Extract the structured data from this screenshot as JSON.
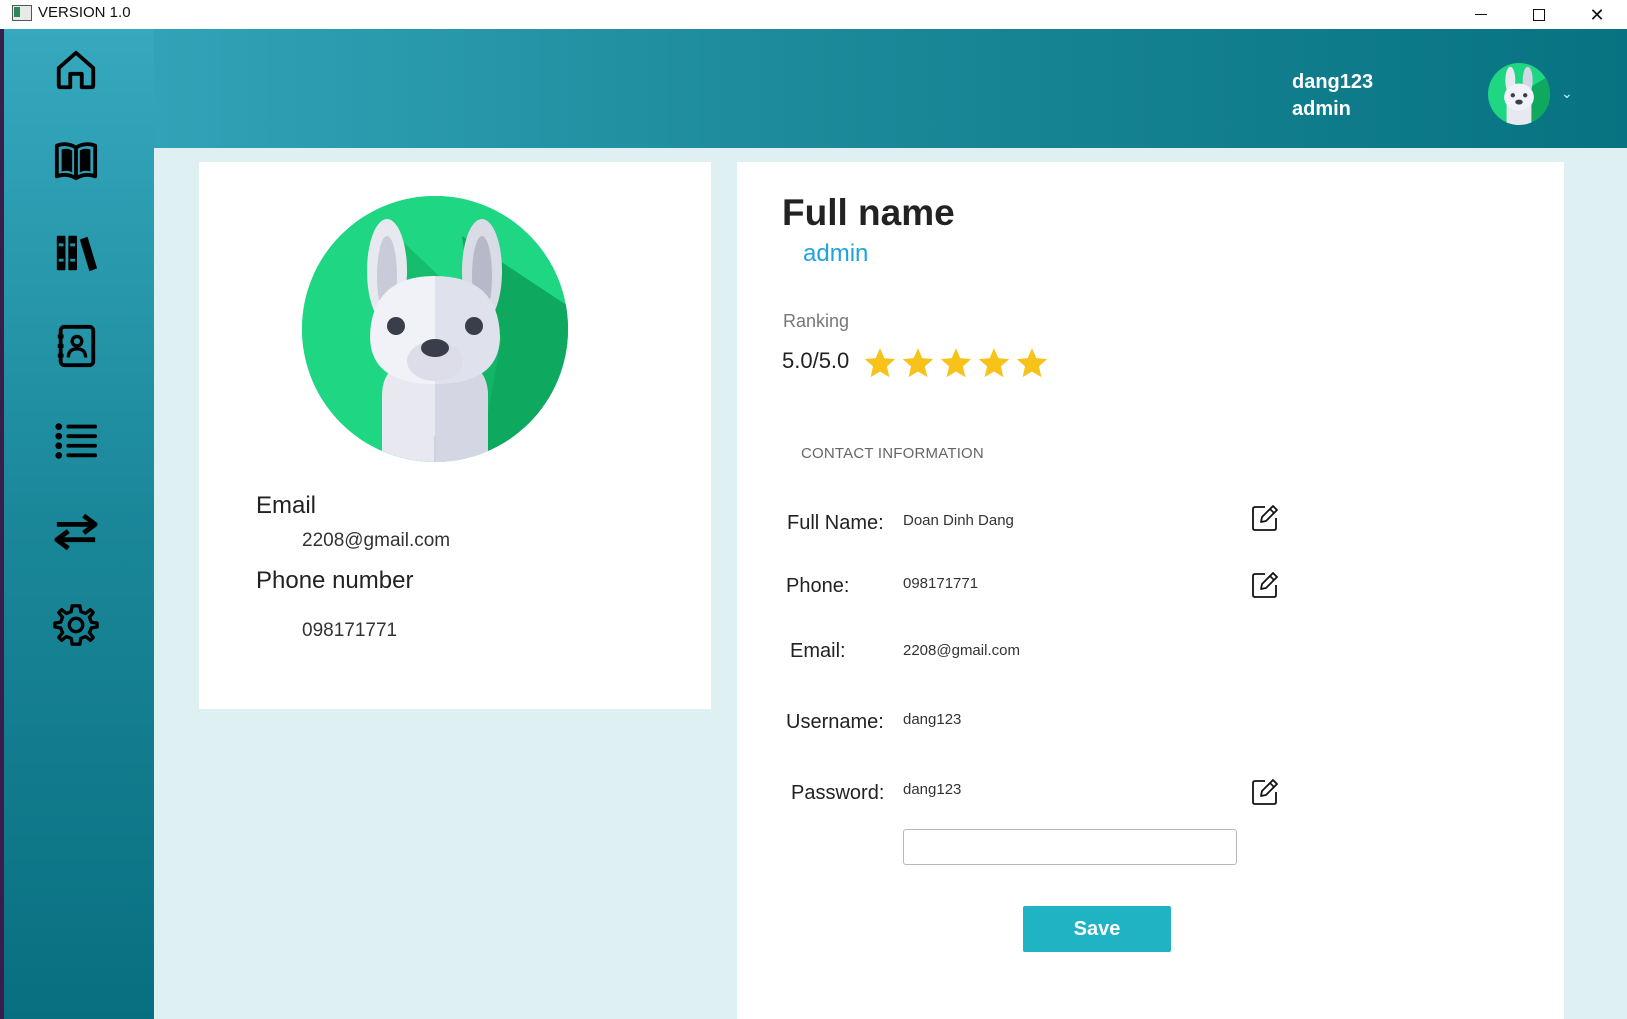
{
  "window": {
    "title": "VERSION 1.0"
  },
  "sidebar": {
    "items": [
      {
        "icon": "home-icon"
      },
      {
        "icon": "book-icon"
      },
      {
        "icon": "library-icon"
      },
      {
        "icon": "contacts-icon"
      },
      {
        "icon": "list-icon"
      },
      {
        "icon": "transfer-icon"
      },
      {
        "icon": "settings-icon"
      }
    ]
  },
  "header": {
    "username": "dang123",
    "role": "admin",
    "chevron": "⌄"
  },
  "profile_card": {
    "email_label": "Email",
    "email_value": "2208@gmail.com",
    "phone_label": "Phone number",
    "phone_value": "098171771"
  },
  "details": {
    "full_name": "Full name",
    "role": "admin",
    "ranking_label": "Ranking",
    "ranking_value": "5.0/5.0",
    "rating": 5,
    "rating_max": 5,
    "contact_title": "CONTACT INFORMATION",
    "rows": {
      "full_name": {
        "label": "Full Name:",
        "value": "Doan Dinh Dang"
      },
      "phone": {
        "label": "Phone:",
        "value": "098171771"
      },
      "email": {
        "label": "Email:",
        "value": "2208@gmail.com"
      },
      "username": {
        "label": "Username:",
        "value": "dang123"
      },
      "password": {
        "label": "Password:",
        "value": "dang123"
      }
    },
    "password_input": {
      "value": "",
      "placeholder": ""
    },
    "save_label": "Save"
  },
  "colors": {
    "accent": "#1fb3c3",
    "star": "#f7c21a",
    "role_text": "#1ea3e0",
    "avatar_bg": "#1fd683"
  }
}
